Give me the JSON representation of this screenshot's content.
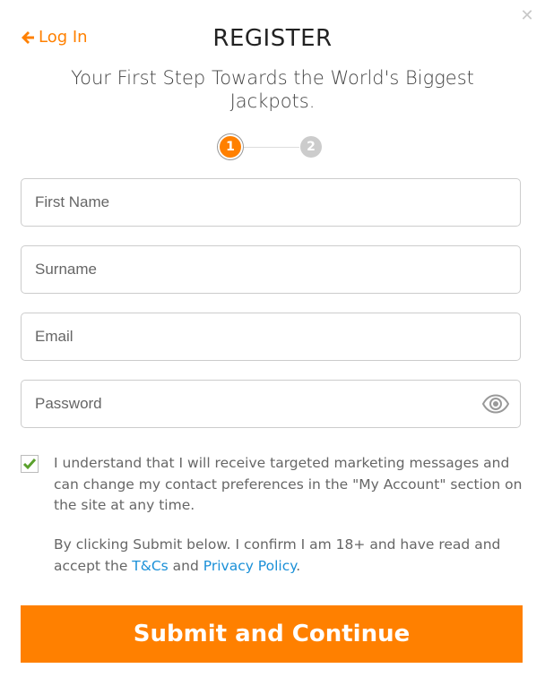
{
  "header": {
    "back_link_label": "Log In",
    "title": "REGISTER",
    "subtitle": "Your First Step Towards the World's Biggest Jackpots."
  },
  "steps": {
    "current": 1,
    "items": [
      "1",
      "2"
    ]
  },
  "form": {
    "first_name": {
      "placeholder": "First Name",
      "value": ""
    },
    "surname": {
      "placeholder": "Surname",
      "value": ""
    },
    "email": {
      "placeholder": "Email",
      "value": ""
    },
    "password": {
      "placeholder": "Password",
      "value": ""
    }
  },
  "consent": {
    "checked": true,
    "text": "I understand that I will receive targeted marketing messages and can change my contact preferences in the \"My Account\" section on the site at any time."
  },
  "terms": {
    "prefix": "By clicking Submit below. I confirm I am 18+ and have read and accept the ",
    "tcs_link": "T&Cs",
    "middle": " and ",
    "privacy_link": "Privacy Policy",
    "suffix": "."
  },
  "submit_label": "Submit and Continue",
  "icons": {
    "close": "close-icon",
    "back": "arrow-left-icon",
    "eye": "eye-icon",
    "check": "checkmark-icon"
  },
  "colors": {
    "accent": "#ff8000",
    "link": "#1a90d8",
    "check": "#5aa02c",
    "step_inactive": "#cccccc"
  }
}
